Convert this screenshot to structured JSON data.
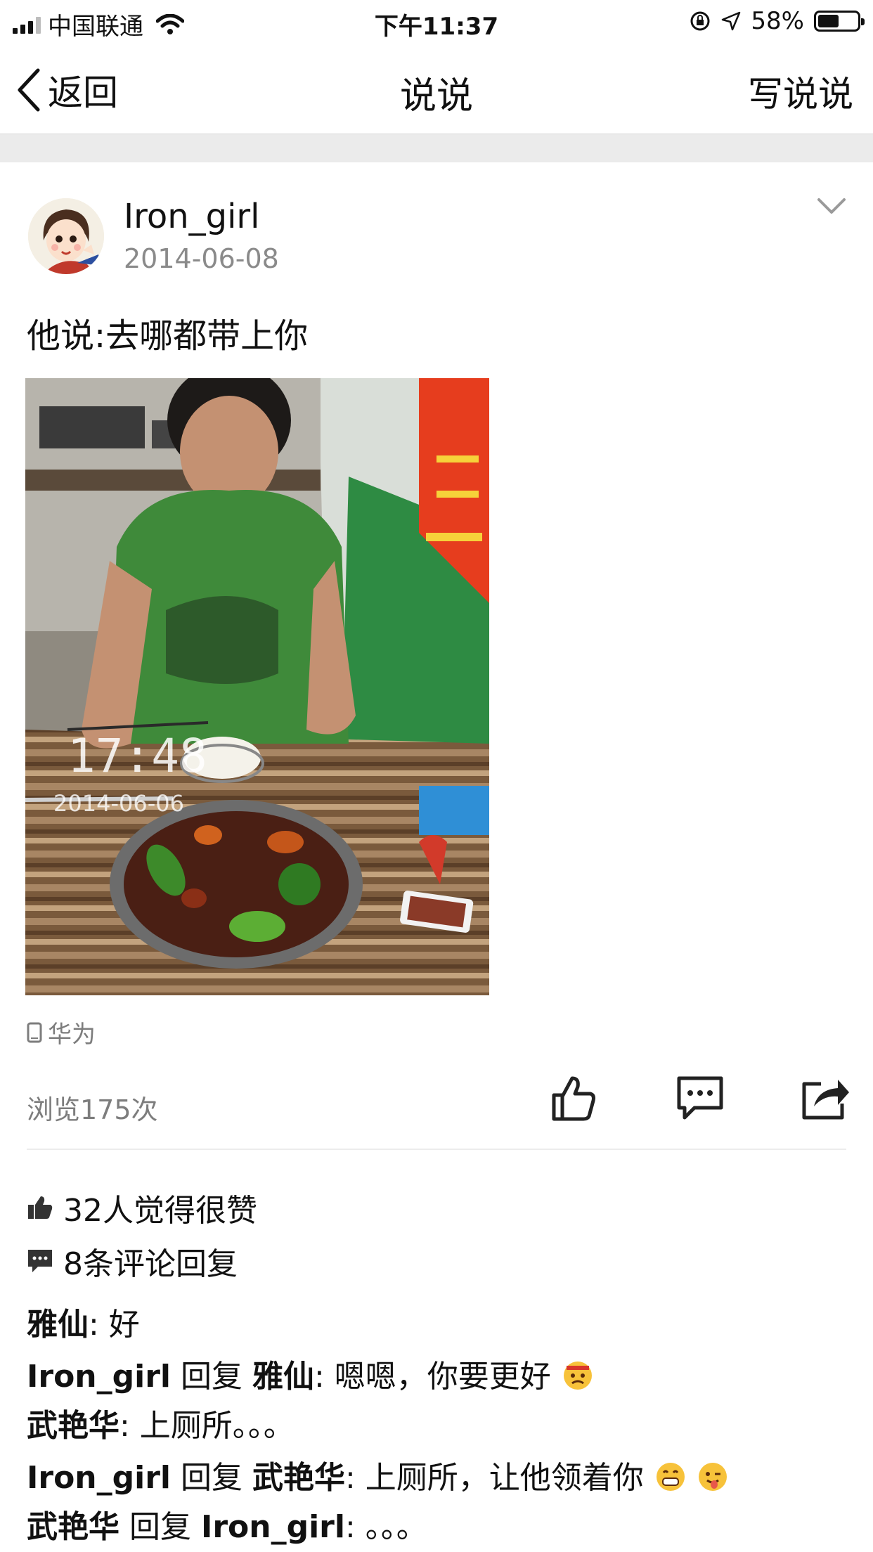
{
  "status_bar": {
    "carrier": "中国联通",
    "time": "下午11:37",
    "battery_percent": "58%",
    "battery_level": 0.58
  },
  "nav": {
    "back_label": "返回",
    "title": "说说",
    "right_label": "写说说"
  },
  "post": {
    "username": "Iron_girl",
    "date": "2014-06-08",
    "text": "他说:去哪都带上你",
    "photo_timestamp_time": "17:48",
    "photo_timestamp_date": "2014-06-06",
    "device": "华为",
    "views": "浏览175次"
  },
  "stats": {
    "likes": "32人觉得很赞",
    "comments": "8条评论回复"
  },
  "comments": [
    {
      "author": "雅仙",
      "reply_word": "",
      "target": "",
      "text": ": 好",
      "emojis": []
    },
    {
      "author": "Iron_girl",
      "reply_word": " 回复 ",
      "target": "雅仙",
      "text": ": 嗯嗯，你要更好",
      "emojis": [
        "angry-face-emoji"
      ]
    },
    {
      "author": "武艳华",
      "reply_word": "",
      "target": "",
      "text": ": 上厕所。。。",
      "emojis": []
    },
    {
      "author": "Iron_girl",
      "reply_word": " 回复 ",
      "target": "武艳华",
      "text": ": 上厕所，让他领着你",
      "emojis": [
        "grinning-face-emoji",
        "winking-tongue-emoji"
      ]
    },
    {
      "author": "武艳华",
      "reply_word": " 回复 ",
      "target": "Iron_girl",
      "text": ": 。。。",
      "emojis": []
    }
  ]
}
